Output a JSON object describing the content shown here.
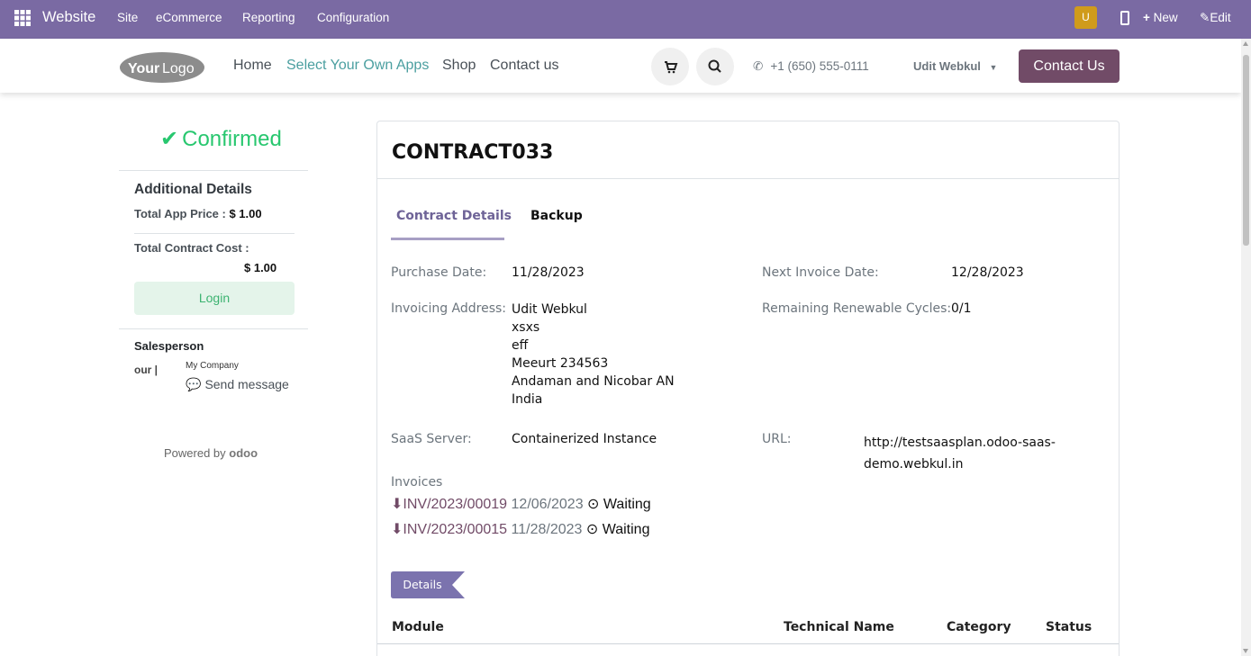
{
  "topbar": {
    "app_name": "Website",
    "menu": [
      "Site",
      "eCommerce",
      "Reporting",
      "Configuration"
    ],
    "avatar_letter": "U",
    "new_label": "New",
    "edit_label": "Edit",
    "bg_color": "#7a6aa3"
  },
  "header": {
    "logo_text_a": "Your",
    "logo_text_b": "Logo",
    "nav": [
      "Home",
      "Select Your Own Apps",
      "Shop",
      "Contact us"
    ],
    "phone": "+1 (650) 555-0111",
    "user": "Udit Webkul",
    "contact_button": "Contact Us",
    "accent_color": "#714b67"
  },
  "sidebar": {
    "status": "Confirmed",
    "additional_title": "Additional Details",
    "app_price_label": "Total App Price :",
    "app_price_value": "$ 1.00",
    "contract_cost_label": "Total Contract Cost :",
    "contract_cost_value": "$ 1.00",
    "login_label": "Login",
    "salesperson_title": "Salesperson",
    "salesperson_logo": "our |",
    "company": "My Company",
    "send_message": "Send message",
    "powered_by": "Powered by",
    "powered_brand": "odoo"
  },
  "contract": {
    "title": "CONTRACT033",
    "tabs": [
      "Contract Details",
      "Backup"
    ],
    "purchase_date_label": "Purchase Date:",
    "purchase_date": "11/28/2023",
    "next_invoice_label": "Next Invoice Date:",
    "next_invoice": "12/28/2023",
    "invoicing_address_label": "Invoicing Address:",
    "address_lines": [
      "Udit Webkul",
      "xsxs",
      "eff",
      "Meeurt 234563",
      "Andaman and Nicobar AN",
      "India"
    ],
    "remaining_label": "Remaining Renewable Cycles:",
    "remaining": "0/1",
    "saas_server_label": "SaaS Server:",
    "saas_server": "Containerized Instance",
    "url_label": "URL:",
    "url_line1": "http://testsaasplan.odoo-saas-",
    "url_line2": "demo.webkul.in",
    "invoices_label": "Invoices",
    "invoices": [
      {
        "number": "INV/2023/00019",
        "date": "12/06/2023",
        "status": "Waiting"
      },
      {
        "number": "INV/2023/00015",
        "date": "11/28/2023",
        "status": "Waiting"
      }
    ],
    "details_tag": "Details",
    "table_headers": [
      "Module",
      "Technical Name",
      "Category",
      "Status"
    ]
  }
}
